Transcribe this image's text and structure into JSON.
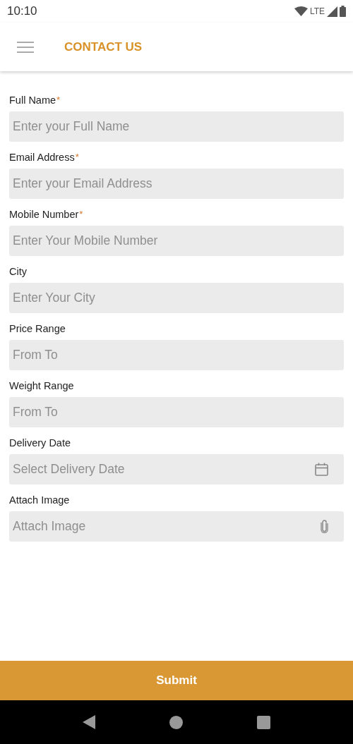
{
  "status_bar": {
    "time": "10:10",
    "network": "LTE"
  },
  "app_bar": {
    "title": "CONTACT US"
  },
  "fields": [
    {
      "kind": "text",
      "label": "Full Name",
      "required_mark": "*",
      "placeholder": "Enter your Full Name"
    },
    {
      "kind": "text",
      "label": "Email Address",
      "required_mark": "*",
      "placeholder": "Enter your Email Address"
    },
    {
      "kind": "text",
      "label": "Mobile Number",
      "required_mark": "*",
      "placeholder": "Enter Your Mobile Number"
    },
    {
      "kind": "text",
      "label": "City",
      "placeholder": "Enter Your City"
    },
    {
      "kind": "text",
      "label": "Price Range",
      "placeholder": "From To"
    },
    {
      "kind": "text",
      "label": "Weight Range",
      "placeholder": "From To"
    },
    {
      "kind": "date",
      "label": "Delivery Date",
      "placeholder": "Select Delivery Date"
    },
    {
      "kind": "attach",
      "label": "Attach Image",
      "placeholder": "Attach Image"
    }
  ],
  "submit_button": "Submit"
}
